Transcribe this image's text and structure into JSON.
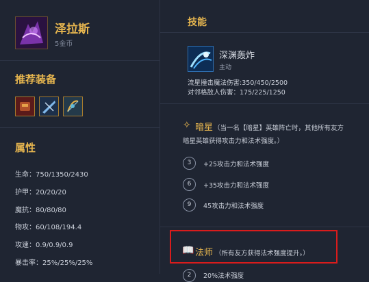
{
  "champion": {
    "name": "泽拉斯",
    "cost": "5金币"
  },
  "recommended": {
    "title": "推荐装备",
    "items": [
      {
        "icon": "item-gauntlet-icon"
      },
      {
        "icon": "item-blade-icon"
      },
      {
        "icon": "item-bow-icon"
      }
    ]
  },
  "attributes": {
    "title": "属性",
    "stats": [
      {
        "label": "生命：750/1350/2430"
      },
      {
        "label": "护甲：20/20/20"
      },
      {
        "label": "魔抗：80/80/80"
      },
      {
        "label": "物攻：60/108/194.4"
      },
      {
        "label": "攻速：0.9/0.9/0.9"
      },
      {
        "label": "暴击率：25%/25%/25%"
      }
    ]
  },
  "skills": {
    "title": "技能",
    "name": "深渊轰炸",
    "type": "主动",
    "desc1": "流星撞击魔法伤害:350/450/2500",
    "desc2": "对邻格敌人伤害：175/225/1250"
  },
  "trait_dark_star": {
    "name": "暗星",
    "note1": "（当一名【暗星】英雄阵亡时，其他所有友方",
    "note2": "暗星英雄获得攻击力和法术强度。）",
    "tiers": [
      {
        "level": "3",
        "text": "+25攻击力和法术强度"
      },
      {
        "level": "6",
        "text": "+35攻击力和法术强度"
      },
      {
        "level": "9",
        "text": "45攻击力和法术强度"
      }
    ]
  },
  "trait_sorcerer": {
    "name": "法师",
    "note": "（所有友方获得法术强度提升。）",
    "partial_tier_level": "2",
    "partial_tier_text": "20%法术强度"
  },
  "colors": {
    "accent": "#e7b64f",
    "highlight": "#d91c1c",
    "background": "#1f2532"
  }
}
